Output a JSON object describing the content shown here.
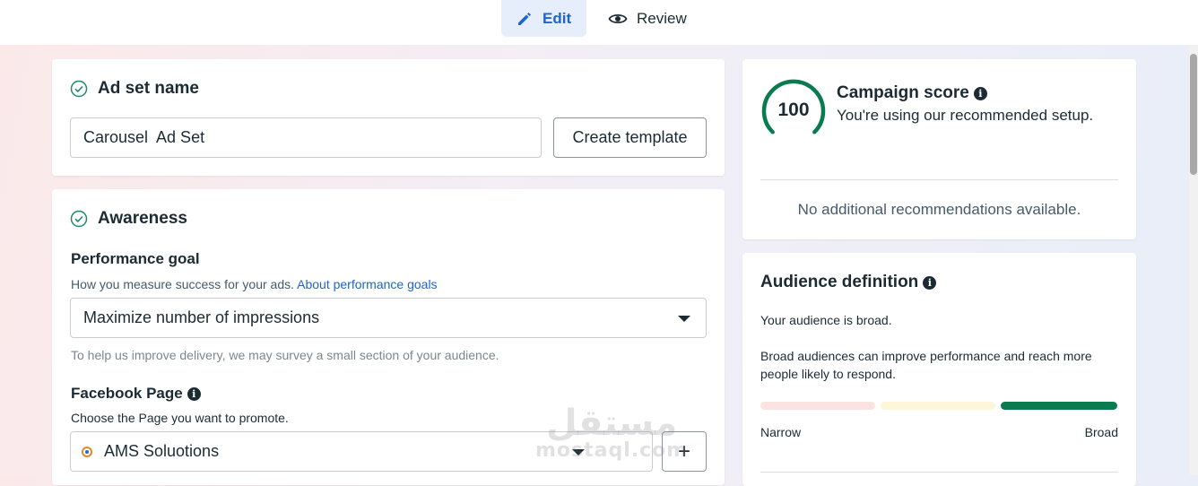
{
  "tabs": {
    "edit": "Edit",
    "review": "Review"
  },
  "ad_set": {
    "title": "Ad set name",
    "name_value": "Carousel  Ad Set",
    "create_template": "Create template"
  },
  "awareness": {
    "title": "Awareness",
    "performance_goal_label": "Performance goal",
    "performance_goal_desc": "How you measure success for your ads.",
    "performance_goal_link": "About performance goals",
    "performance_goal_value": "Maximize number of impressions",
    "survey_note": "To help us improve delivery, we may survey a small section of your audience.",
    "facebook_page_label": "Facebook Page",
    "facebook_page_desc": "Choose the Page you want to promote.",
    "facebook_page_value": "AMS Soluotions",
    "add_button": "+"
  },
  "campaign_score": {
    "score": "100",
    "score_value": 100,
    "title": "Campaign score",
    "subtitle": "You're using our recommended setup.",
    "recommendations": "No additional recommendations available."
  },
  "audience": {
    "title": "Audience definition",
    "broad_text": "Your audience is broad.",
    "explanation": "Broad audiences can improve performance and reach more people likely to respond.",
    "narrow_label": "Narrow",
    "broad_label": "Broad",
    "level": "broad"
  },
  "watermark": {
    "arabic": "مستقل",
    "latin": "mostaql.com"
  },
  "colors": {
    "accent": "#1d63d4",
    "success": "#0a7a4f",
    "bar_narrow": "#fbe3e3",
    "bar_mid": "#fdf6d8",
    "bar_broad": "#0a7a4f"
  }
}
